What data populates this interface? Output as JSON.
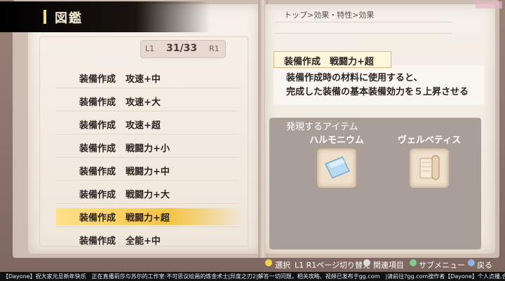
{
  "header": {
    "title": "図鑑"
  },
  "pager": {
    "left_button": "L1",
    "page": "31/33",
    "right_button": "R1"
  },
  "list": [
    {
      "category": "装備作成",
      "effect": "攻速+中"
    },
    {
      "category": "装備作成",
      "effect": "攻速+大"
    },
    {
      "category": "装備作成",
      "effect": "攻速+超"
    },
    {
      "category": "装備作成",
      "effect": "戦闘力+小"
    },
    {
      "category": "装備作成",
      "effect": "戦闘力+中"
    },
    {
      "category": "装備作成",
      "effect": "戦闘力+大"
    },
    {
      "category": "装備作成",
      "effect": "戦闘力+超"
    },
    {
      "category": "装備作成",
      "effect": "全能+中"
    }
  ],
  "right": {
    "breadcrumb": "トップ>効果・特性>効果",
    "effect_title": "装備作成　戦闘力+超",
    "desc_line1": "装備作成時の材料に使用すると、",
    "desc_line2": "完成した装備の基本装備効力を５上昇させる",
    "items_header": "発現するアイテム",
    "items": [
      {
        "name": "ハルモニウム",
        "icon": "metal-ingot-icon"
      },
      {
        "name": "ヴェルベティス",
        "icon": "cloth-roll-icon"
      }
    ]
  },
  "controls": {
    "select": "選択",
    "page_switch": "L1 R1ページ切り替え",
    "related": "関連項目",
    "submenu": "サブメニュー",
    "back": "戻る"
  },
  "ticker": "【Dayone】祝大家元旦新年快乐　正在直播莉莎与苏尔的工作室·不可思议绘画的炼金术士|异度之刃2|解答一切问题，相关攻略、视频已发布于gg.com　|请前往?gg.com搜作者【Dayone】个人点播,合作联系"
}
